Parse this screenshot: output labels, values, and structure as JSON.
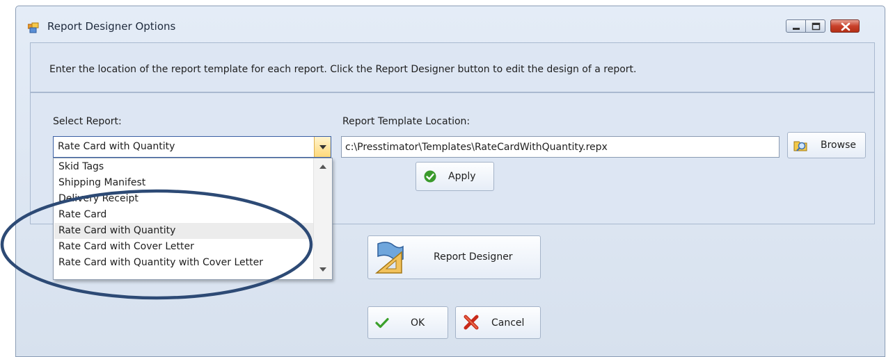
{
  "window": {
    "title": "Report Designer Options",
    "accent": "#3a5fa3"
  },
  "info": {
    "text": "Enter the location of the report template for each report.  Click the Report Designer button to edit the design of a report."
  },
  "select_report": {
    "label": "Select Report:",
    "value": "Rate Card with Quantity",
    "options": [
      "Skid Tags",
      "Shipping Manifest",
      "Delivery Receipt",
      "Rate Card",
      "Rate Card with Quantity",
      "Rate Card with Cover Letter",
      "Rate Card with Quantity with Cover Letter"
    ]
  },
  "template": {
    "label": "Report Template Location:",
    "value": "c:\\Presstimator\\Templates\\RateCardWithQuantity.repx"
  },
  "buttons": {
    "browse": "Browse",
    "apply": "Apply",
    "report_designer": "Report Designer",
    "ok": "OK",
    "cancel": "Cancel"
  },
  "icons": {
    "app": "window-form-icon",
    "browse": "folder-search-icon",
    "apply": "check-circle-icon",
    "report_designer": "flag-ruler-icon",
    "ok": "checkmark-icon",
    "cancel": "red-x-icon"
  },
  "annotation": {
    "color": "#2d4a75"
  }
}
